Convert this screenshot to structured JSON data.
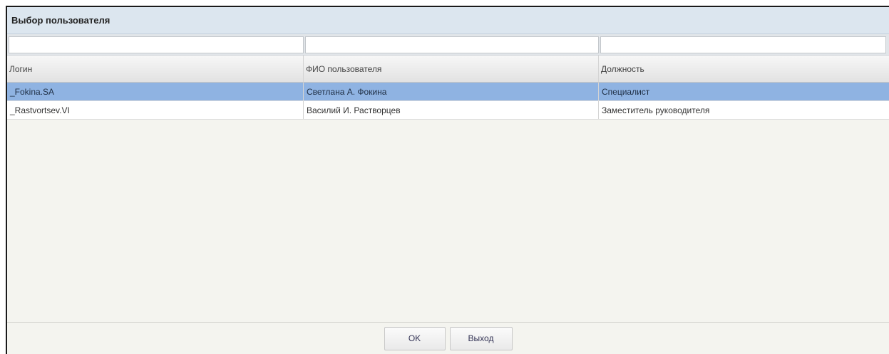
{
  "dialog": {
    "title": "Выбор пользователя"
  },
  "filters": {
    "login_value": "",
    "fio_value": "",
    "position_value": ""
  },
  "grid": {
    "columns": [
      {
        "label": "Логин"
      },
      {
        "label": "ФИО пользователя"
      },
      {
        "label": "Должность"
      }
    ],
    "rows": [
      {
        "login": "_Fokina.SA",
        "fio": "Светлана А. Фокина",
        "position": "Специалист",
        "selected": true
      },
      {
        "login": "_Rastvortsev.VI",
        "fio": "Василий И. Растворцев",
        "position": "Заместитель руководителя",
        "selected": false
      }
    ]
  },
  "footer": {
    "ok_label": "OK",
    "exit_label": "Выход"
  },
  "colors": {
    "titlebar": "#dce6ef",
    "selected_row": "#8fb3e2",
    "body": "#f4f4ef"
  }
}
